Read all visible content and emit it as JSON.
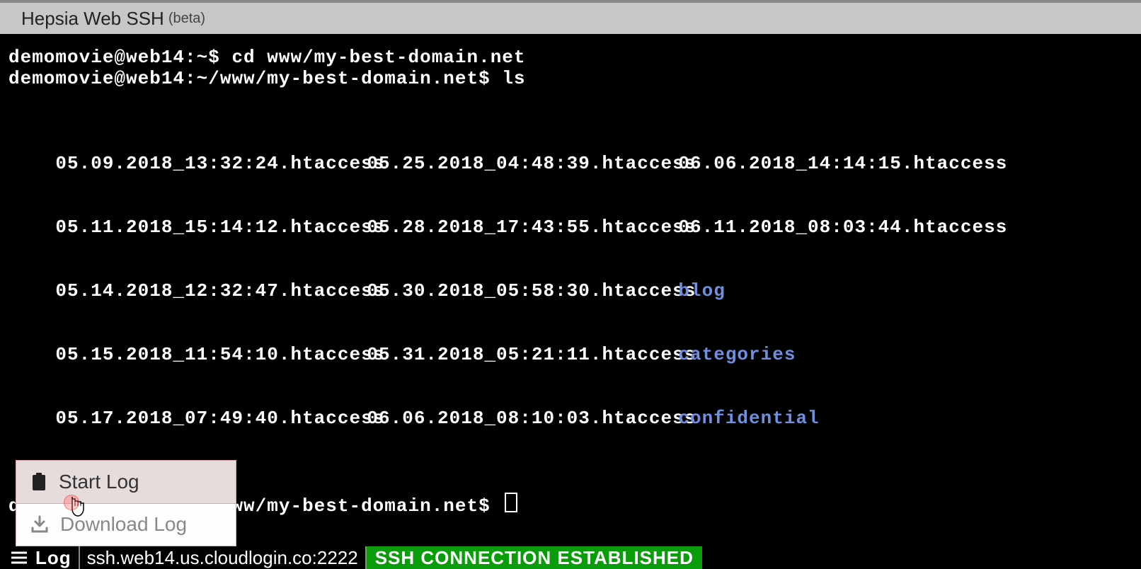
{
  "header": {
    "title": "Hepsia Web SSH",
    "suffix": "(beta)"
  },
  "terminal": {
    "line1_prompt": "demomovie@web14:~$ ",
    "line1_cmd": "cd www/my-best-domain.net",
    "line2_prompt": "demomovie@web14:~/www/my-best-domain.net$ ",
    "line2_cmd": "ls",
    "cols": {
      "c1": [
        "05.09.2018_13:32:24.htaccess",
        "05.11.2018_15:14:12.htaccess",
        "05.14.2018_12:32:47.htaccess",
        "05.15.2018_11:54:10.htaccess",
        "05.17.2018_07:49:40.htaccess"
      ],
      "c2": [
        "05.25.2018_04:48:39.htaccess",
        "05.28.2018_17:43:55.htaccess",
        "05.30.2018_05:58:30.htaccess",
        "05.31.2018_05:21:11.htaccess",
        "06.06.2018_08:10:03.htaccess"
      ],
      "c3_files": [
        "06.06.2018_14:14:15.htaccess",
        "06.11.2018_08:03:44.htaccess"
      ],
      "c3_dirs": [
        "blog",
        "categories",
        "confidential"
      ]
    },
    "line_end_prompt": "demomovie@web14:~/www/my-best-domain.net$"
  },
  "popup": {
    "start": "Start Log",
    "download": "Download Log"
  },
  "status": {
    "log": "Log",
    "host": "ssh.web14.us.cloudlogin.co:2222",
    "conn": "SSH CONNECTION ESTABLISHED"
  }
}
